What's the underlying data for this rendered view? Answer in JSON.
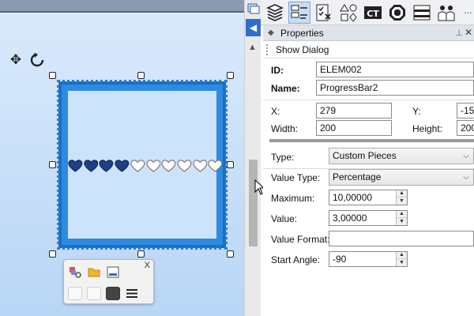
{
  "toolbar": {
    "buttons": [
      {
        "name": "layers-icon",
        "active": false
      },
      {
        "name": "properties-icon",
        "active": true
      },
      {
        "name": "checklist-icon",
        "active": false
      },
      {
        "name": "shapes-icon",
        "active": false
      },
      {
        "name": "ct-icon",
        "label": "CT",
        "active": false
      },
      {
        "name": "octagon-icon",
        "active": false
      },
      {
        "name": "panel-list-icon",
        "active": false
      },
      {
        "name": "users-icon",
        "active": false
      }
    ],
    "more": "…"
  },
  "panel": {
    "title": "Properties",
    "show_dialog": "Show Dialog",
    "fields": {
      "id_label": "ID:",
      "id_value": "ELEM002",
      "name_label": "Name:",
      "name_value": "ProgressBar2",
      "x_label": "X:",
      "x_value": "279",
      "y_label": "Y:",
      "y_value": "-15",
      "width_label": "Width:",
      "width_value": "200",
      "height_label": "Height:",
      "height_value": "200",
      "type_label": "Type:",
      "type_value": "Custom Pieces",
      "value_type_label": "Value Type:",
      "value_type_value": "Percentage",
      "maximum_label": "Maximum:",
      "maximum_value": "10,00000",
      "value_label": "Value:",
      "value_value": "3,00000",
      "value_format_label": "Value Format:",
      "value_format_value": "",
      "start_angle_label": "Start Angle:",
      "start_angle_value": "-90"
    }
  },
  "progress": {
    "pieces_total": 10,
    "pieces_filled": 4,
    "filled_color": "#1f3f86",
    "empty_color": "#ffffff"
  },
  "mini_toolbar": {
    "close": "X"
  },
  "colors": {
    "accent": "#2f6fcc",
    "element_fill": "#2e8ae0",
    "canvas_bg": "#cfe3fa"
  }
}
